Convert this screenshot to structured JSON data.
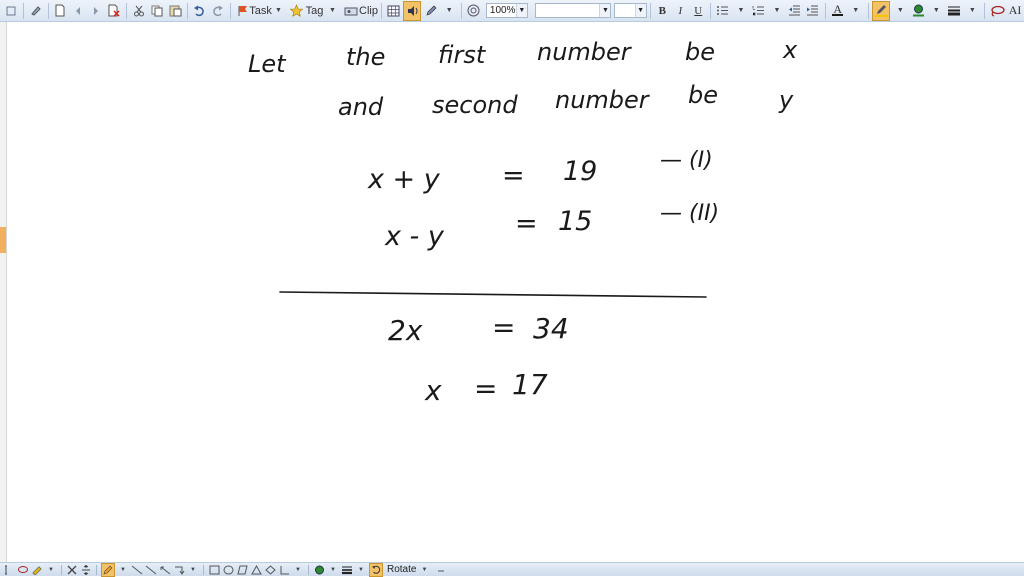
{
  "toolbar": {
    "task_label": "Task",
    "tag_label": "Tag",
    "clip_label": "Clip",
    "zoom_value": "100%",
    "font_name_value": "",
    "font_size_value": "",
    "bold_label": "B",
    "italic_label": "I",
    "underline_label": "U",
    "font_color_label": "A",
    "text_ai_label": "AI",
    "highlight_color": "#f5c400",
    "pen_color": "#2d8a2d"
  },
  "bottom_toolbar": {
    "rotate_label": "Rotate",
    "pen_color": "#f0a020"
  },
  "notes": {
    "line1": [
      "Let",
      "the",
      "first",
      "number",
      "be",
      "x"
    ],
    "line2": [
      "and",
      "second",
      "number",
      "be",
      "y"
    ],
    "eq1": {
      "lhs": "x + y",
      "eq": "=",
      "rhs": "19",
      "tag": "— (I)"
    },
    "eq2": {
      "lhs": "x - y",
      "eq": "=",
      "rhs": "15",
      "tag": "— (II)"
    },
    "eq3": {
      "lhs": "2x",
      "eq": "=",
      "rhs": "34"
    },
    "eq4": {
      "lhs": "x",
      "eq": "=",
      "rhs": "17"
    }
  }
}
